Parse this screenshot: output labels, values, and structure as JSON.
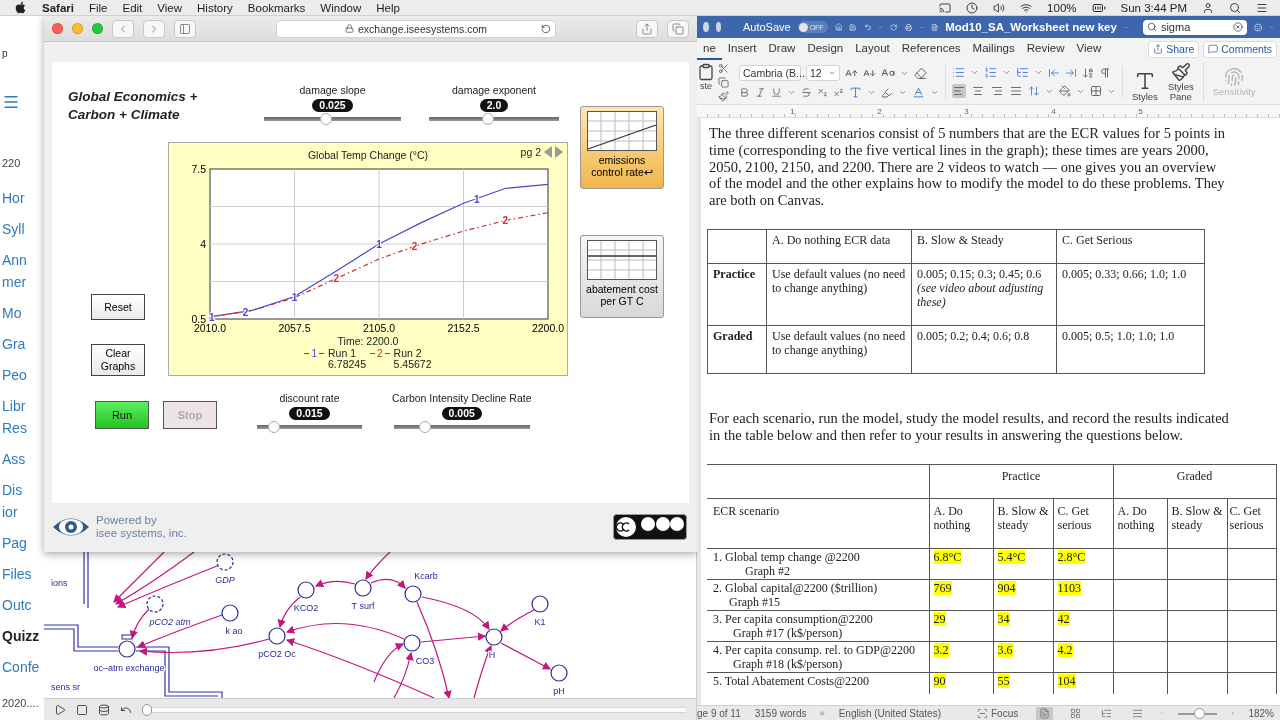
{
  "menubar": {
    "app": "Safari",
    "menus": [
      "File",
      "Edit",
      "View",
      "History",
      "Bookmarks",
      "Window",
      "Help"
    ],
    "battery": "100%",
    "clock": "Sun 3:44 PM"
  },
  "canvas_nav": {
    "tab_text": "p",
    "top_note": "220",
    "items": [
      {
        "lines": [
          "Hor"
        ],
        "selected": false
      },
      {
        "lines": [
          "Syll"
        ],
        "selected": false
      },
      {
        "lines": [
          "Ann",
          "mer"
        ],
        "selected": false
      },
      {
        "lines": [
          "Mo"
        ],
        "selected": false
      },
      {
        "lines": [
          "Gra"
        ],
        "selected": false
      },
      {
        "lines": [
          "Peo"
        ],
        "selected": false
      },
      {
        "lines": [
          "Libr",
          "Res"
        ],
        "selected": false
      },
      {
        "lines": [
          "Ass"
        ],
        "selected": false
      },
      {
        "lines": [
          "Dis",
          "ior"
        ],
        "selected": false
      },
      {
        "lines": [
          "Pag"
        ],
        "selected": false
      },
      {
        "lines": [
          "Files"
        ],
        "selected": false
      },
      {
        "lines": [
          "Outc"
        ],
        "selected": false
      },
      {
        "lines": [
          "Quizz"
        ],
        "selected": true
      },
      {
        "lines": [
          "Confe"
        ],
        "selected": false
      }
    ],
    "bottom_note": "2020...."
  },
  "safari": {
    "url": "exchange.iseesystems.com"
  },
  "model": {
    "title_lines": [
      "Global Economics +",
      "Carbon + Climate"
    ],
    "sliders": [
      {
        "label": "damage slope",
        "value": "0.025",
        "level": 0.45
      },
      {
        "label": "damage exponent",
        "value": "2.0",
        "level": 0.45
      }
    ],
    "side_buttons": [
      "Reset",
      "Clear Graphs"
    ],
    "graph": {
      "page": "pg 2",
      "time_label": "Time: 2200.0",
      "legend": [
        {
          "marker": "1",
          "reading": "6.78245"
        },
        {
          "marker": "2",
          "reading": "5.45672"
        }
      ],
      "chart_data": {
        "type": "line",
        "title": "Global Temp Change (°C)",
        "x": [
          2010,
          2033.75,
          2057.5,
          2081.25,
          2105,
          2128.75,
          2152.5,
          2176.25,
          2200
        ],
        "series": [
          {
            "name": "Run 1",
            "color": "#4646d6",
            "line_style": "solid",
            "values": [
              0.6,
              0.9,
              1.55,
              2.75,
              4.0,
              5.0,
              5.9,
              6.6,
              6.78
            ]
          },
          {
            "name": "Run 2",
            "color": "#d42a2a",
            "line_style": "dashed",
            "values": [
              0.6,
              0.9,
              1.5,
              2.4,
              3.3,
              4.0,
              4.6,
              5.1,
              5.46
            ]
          }
        ],
        "xlim": [
          2010,
          2200
        ],
        "ylim": [
          0.5,
          7.5
        ],
        "grid": true,
        "xticks": [
          {
            "value": 2010,
            "label": "2010.0"
          },
          {
            "value": 2057.5,
            "label": "2057.5"
          },
          {
            "value": 2105,
            "label": "2105.0"
          },
          {
            "value": 2152.5,
            "label": "2152.5"
          },
          {
            "value": 2200,
            "label": "2200.0"
          }
        ],
        "yticks": [
          {
            "value": 0.5,
            "label": "0.5"
          },
          {
            "value": 4,
            "label": "4"
          },
          {
            "value": 7.5,
            "label": "7.5"
          }
        ],
        "annotations": [
          {
            "text": "1",
            "x": 2011,
            "y": 0.6
          },
          {
            "text": "1",
            "x": 2057.5,
            "y": 1.55
          },
          {
            "text": "1",
            "x": 2105,
            "y": 4.0
          },
          {
            "text": "1",
            "x": 2160,
            "y": 6.1
          },
          {
            "text": "2",
            "x": 2030,
            "y": 0.85
          },
          {
            "text": "2",
            "x": 2081,
            "y": 2.4
          },
          {
            "text": "2",
            "x": 2125,
            "y": 3.9
          },
          {
            "text": "2",
            "x": 2176,
            "y": 5.1
          }
        ]
      }
    },
    "pads": [
      {
        "label": "emissions control rate↩",
        "selected": true,
        "kind": "line"
      },
      {
        "label": "abatement cost per GT C",
        "selected": false,
        "kind": "table"
      }
    ],
    "run_buttons": [
      {
        "label": "Run",
        "kind": "run",
        "disabled": false
      },
      {
        "label": "Stop",
        "kind": "stop",
        "disabled": true
      }
    ],
    "lower_sliders": [
      {
        "label": "discount rate",
        "value": "0.015",
        "level": 0.12
      },
      {
        "label": "Carbon Intensity Decline Rate",
        "value": "0.005",
        "level": 0.2
      }
    ],
    "footer": {
      "lines": [
        "Powered by",
        "isee systems, inc."
      ]
    }
  },
  "stella": {
    "nodes": [
      {
        "label": "ions",
        "kind": "text"
      },
      {
        "label": "GDP",
        "kind": "ghost"
      },
      {
        "label": "pCO2 atm",
        "kind": "ghost"
      },
      {
        "label": "k ao",
        "kind": "converter"
      },
      {
        "label": "oc–atm exchange",
        "kind": "valve"
      },
      {
        "label": "KCO2",
        "kind": "converter"
      },
      {
        "label": "T surf",
        "kind": "converter"
      },
      {
        "label": "Kcarb",
        "kind": "converter"
      },
      {
        "label": "pCO2 Oc",
        "kind": "converter"
      },
      {
        "label": "CO3",
        "kind": "converter"
      },
      {
        "label": "H",
        "kind": "converter"
      },
      {
        "label": "K1",
        "kind": "converter"
      },
      {
        "label": "pH",
        "kind": "converter"
      },
      {
        "label": "sens sr",
        "kind": "text"
      }
    ],
    "playback": {
      "level": 0
    }
  },
  "word": {
    "autosave": {
      "label": "AutoSave",
      "on": false,
      "state_text": "OFF"
    },
    "doc_title": "Mod10_SA_Worksheet new key",
    "search": {
      "value": "sigma"
    },
    "tabs": [
      {
        "label": "ne",
        "selected": true
      },
      {
        "label": "Insert",
        "selected": false
      },
      {
        "label": "Draw",
        "selected": false
      },
      {
        "label": "Design",
        "selected": false
      },
      {
        "label": "Layout",
        "selected": false
      },
      {
        "label": "References",
        "selected": false
      },
      {
        "label": "Mailings",
        "selected": false
      },
      {
        "label": "Review",
        "selected": false
      },
      {
        "label": "View",
        "selected": false
      }
    ],
    "share": "Share",
    "comments": "Comments",
    "ribbon": {
      "paste_label": "ste",
      "font": "Cambria (B...",
      "size": "12",
      "align": [
        {
          "selected": true
        },
        {
          "selected": false
        },
        {
          "selected": false
        },
        {
          "selected": false
        }
      ],
      "styles": "Styles",
      "styles_pane_lines": [
        "Styles",
        "Pane"
      ],
      "sensitivity": {
        "label": "Sensitivity",
        "disabled": true
      }
    },
    "ruler": [
      "1",
      "2",
      "3",
      "4",
      "5"
    ],
    "blocks": [
      {
        "kind": "paragraph",
        "text": "The three different scenarios consist of 5 numbers that are the ECR values for 5 points in time (corresponding to the five vertical lines in the graph); these times are years 2000, 2050, 2100, 2150, and 2200.  There are 2 videos to watch — one gives you an overview of the model and the other explains how to modify the model to do these problems. They are both on Canvas."
      },
      {
        "kind": "scenario_table",
        "columns": [
          "A. Do nothing ECR data",
          "B. Slow & Steady",
          "C. Get Serious"
        ],
        "rows": [
          {
            "label": "Practice",
            "cells": [
              "Use default values (no need to change anything)",
              "0.005; 0.15; 0.3; 0.45; 0.6 *(see video about adjusting these)*",
              "0.005; 0.33; 0.66; 1.0; 1.0"
            ]
          },
          {
            "label": "Graded",
            "cells": [
              "Use default values (no need to change anything)",
              "0.005; 0.2; 0.4; 0.6; 0.8",
              "0.005; 0.5; 1.0; 1.0; 1.0"
            ]
          }
        ]
      },
      {
        "kind": "paragraph",
        "text": "For each scenario, run the model, study the model results, and record the results indicated in the table below and then refer to your results in answering the questions below."
      },
      {
        "kind": "results_table",
        "groups": [
          "Practice",
          "Graded"
        ],
        "columns": [
          "ECR scenario",
          "A. Do nothing",
          "B. Slow & steady",
          "C. Get serious",
          "A. Do nothing",
          "B. Slow & steady",
          "C. Get serious"
        ],
        "rows": [
          {
            "cells": [
              {
                "text": "1. Global temp change @2200",
                "sub": "Graph #2",
                "highlighted": false
              },
              {
                "text": "6.8°C",
                "highlighted": true
              },
              {
                "text": "5.4°C",
                "highlighted": true
              },
              {
                "text": "2.8°C",
                "highlighted": true
              }
            ]
          },
          {
            "cells": [
              {
                "text": "2. Global capital@2200 ($trillion)",
                "sub": "Graph #15",
                "highlighted": false
              },
              {
                "text": "769",
                "highlighted": true
              },
              {
                "text": "904",
                "highlighted": true
              },
              {
                "text": "1103",
                "highlighted": true
              }
            ]
          },
          {
            "cells": [
              {
                "text": "3. Per capita consumption@2200",
                "sub": "Graph #17  (k$/person)",
                "highlighted": false
              },
              {
                "text": "29",
                "highlighted": true
              },
              {
                "text": "34",
                "highlighted": true
              },
              {
                "text": "42",
                "highlighted": true
              }
            ]
          },
          {
            "cells": [
              {
                "text": "4. Per capita consump. rel. to GDP@2200",
                "sub": "Graph #18  (k$/person)",
                "highlighted": false
              },
              {
                "text": "3.2",
                "highlighted": true
              },
              {
                "text": "3.6",
                "highlighted": true
              },
              {
                "text": "4.2",
                "highlighted": true
              }
            ]
          },
          {
            "cells": [
              {
                "text": "5. Total Abatement Costs@2200",
                "highlighted": false
              },
              {
                "text": "90",
                "highlighted": true
              },
              {
                "text": "55",
                "highlighted": true
              },
              {
                "text": "104",
                "highlighted": true
              }
            ]
          }
        ]
      }
    ]
  },
  "status": {
    "page": "ge 9 of 11",
    "words": "3159 words",
    "language": "English (United States)",
    "focus": "Focus",
    "views": [
      {
        "selected": true
      },
      {
        "selected": false
      },
      {
        "selected": false
      },
      {
        "selected": false
      }
    ],
    "zoom": {
      "level": 0.58,
      "value": "182%"
    }
  }
}
